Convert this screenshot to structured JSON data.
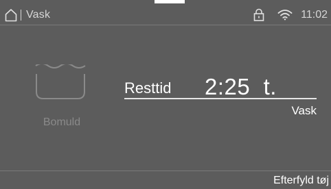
{
  "status_bar": {
    "home_icon": "home-icon",
    "title": "Vask",
    "lock_icon": "lock-icon",
    "wifi_icon": "wifi-icon",
    "time": "11:02"
  },
  "program": {
    "icon": "washtub-icon",
    "name": "Bomuld"
  },
  "remaining": {
    "label": "Resttid",
    "value": "2:25  t.",
    "phase": "Vask"
  },
  "footer": {
    "action": "Efterfyld tøj"
  },
  "colors": {
    "background": "#5c5c5c",
    "text": "#ffffff",
    "muted_text": "#8a8a8a"
  }
}
